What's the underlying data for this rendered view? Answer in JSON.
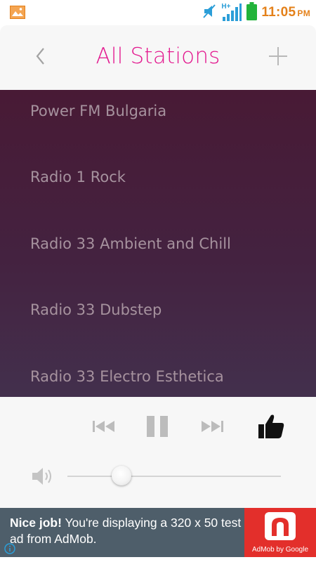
{
  "status_bar": {
    "time": "11:05",
    "ampm": "PM",
    "network_label": "H+",
    "accent_color": "#e4811a"
  },
  "header": {
    "title": "All Stations",
    "title_color": "#e3198f",
    "back_icon": "chevron-left-icon",
    "add_icon": "plus-icon"
  },
  "stations": [
    {
      "name": "Power FM Bulgaria"
    },
    {
      "name": "Radio 1 Rock"
    },
    {
      "name": "Radio 33 Ambient and Chill"
    },
    {
      "name": "Radio 33 Dubstep"
    },
    {
      "name": "Radio 33 Electro Esthetica"
    }
  ],
  "player": {
    "controls": [
      "previous-icon",
      "pause-icon",
      "next-icon",
      "thumbs-up-icon"
    ],
    "volume_level": 0.25
  },
  "ad": {
    "headline": "Nice job!",
    "body": "You're displaying a 320 x 50 test ad from AdMob.",
    "brand_caption": "AdMob by Google",
    "brand_color": "#e32f2b"
  }
}
